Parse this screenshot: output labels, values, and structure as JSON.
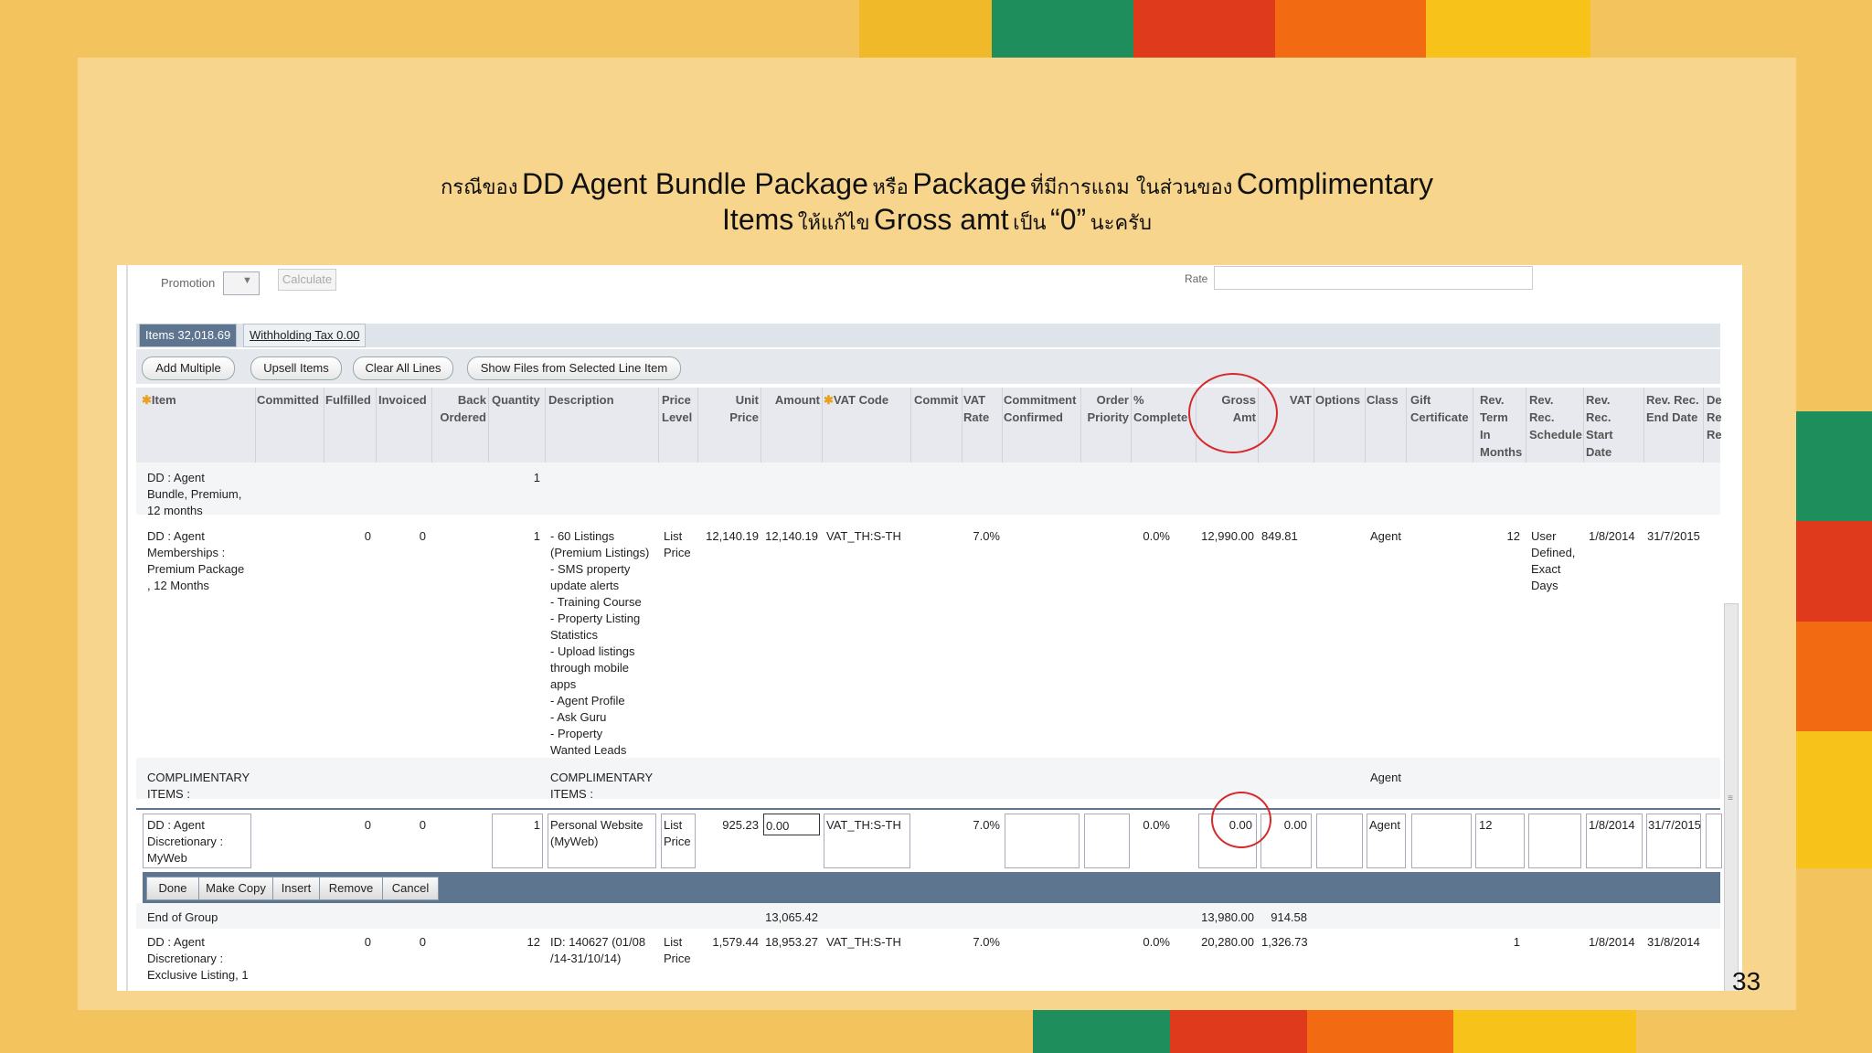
{
  "caption": {
    "line1_th1": "กรณีของ",
    "line1_en1": "DD Agent Bundle Package",
    "line1_th2": "หรือ",
    "line1_en2": "Package",
    "line1_th3": "ที่มีการแถม ในส่วนของ",
    "line1_en3": "Complimentary",
    "line2_en1": "Items",
    "line2_th1": "ให้แก้ไข",
    "line2_en2": "Gross amt",
    "line2_th2": "เป็น",
    "line2_en3": "“0”",
    "line2_th3": "นะครับ"
  },
  "page_number": "33",
  "form": {
    "promotion_label": "Promotion",
    "calculate_label": "Calculate",
    "rate_label": "Rate"
  },
  "tabs": {
    "items": "Items 32,018.69",
    "withholding": "Withholding Tax 0.00"
  },
  "toolbar": {
    "add_multiple": "Add Multiple",
    "upsell": "Upsell Items",
    "clear_all": "Clear All Lines",
    "show_files": "Show Files from Selected Line Item"
  },
  "headers": {
    "item": "Item",
    "committed": "Committed",
    "fulfilled": "Fulfilled",
    "invoiced": "Invoiced",
    "back_ordered_1": "Back",
    "back_ordered_2": "Ordered",
    "quantity": "Quantity",
    "description": "Description",
    "price_level_1": "Price",
    "price_level_2": "Level",
    "unit_price_1": "Unit",
    "unit_price_2": "Price",
    "amount": "Amount",
    "vat_code": "VAT Code",
    "commit": "Commit",
    "vat_rate_1": "VAT",
    "vat_rate_2": "Rate",
    "commitment_1": "Commitment",
    "commitment_2": "Confirmed",
    "order_priority_1": "Order",
    "order_priority_2": "Priority",
    "pct_complete_1": "%",
    "pct_complete_2": "Complete",
    "gross_amt_1": "Gross",
    "gross_amt_2": "Amt",
    "vat": "VAT",
    "options": "Options",
    "class": "Class",
    "gift_1": "Gift",
    "gift_2": "Certificate",
    "rev_term_1": "Rev.",
    "rev_term_2": "Term",
    "rev_term_3": "In",
    "rev_term_4": "Months",
    "rev_sched_1": "Rev.",
    "rev_sched_2": "Rec.",
    "rev_sched_3": "Schedule",
    "rev_start_1": "Rev.",
    "rev_start_2": "Rec.",
    "rev_start_3": "Start",
    "rev_start_4": "Date",
    "rev_end_1": "Rev. Rec.",
    "rev_end_2": "End Date",
    "de_1": "De",
    "de_2": "Re",
    "de_3": "Re"
  },
  "rows": {
    "bundle": {
      "item_1": "DD : Agent",
      "item_2": "Bundle, Premium,",
      "item_3": "12 months",
      "quantity": "1"
    },
    "membership": {
      "item_1": "DD : Agent",
      "item_2": "Memberships :",
      "item_3": "Premium Package",
      "item_4": ", 12 Months",
      "fulfilled": "0",
      "invoiced": "0",
      "quantity": "1",
      "desc": [
        "- 60 Listings",
        "(Premium Listings)",
        "- SMS property",
        "update alerts",
        "- Training Course",
        "- Property Listing",
        "Statistics",
        "- Upload listings",
        "through mobile",
        "apps",
        "- Agent Profile",
        "- Ask Guru",
        "- Property",
        "Wanted Leads"
      ],
      "price_level_1": "List",
      "price_level_2": "Price",
      "unit_price": "12,140.19",
      "amount": "12,140.19",
      "vat_code": "VAT_TH:S-TH",
      "vat_rate": "7.0%",
      "pct_complete": "0.0%",
      "gross_amt": "12,990.00",
      "vat": "849.81",
      "class": "Agent",
      "rev_term": "12",
      "rev_sched_1": "User",
      "rev_sched_2": "Defined,",
      "rev_sched_3": "Exact",
      "rev_sched_4": "Days",
      "rev_start": "1/8/2014",
      "rev_end": "31/7/2015"
    },
    "complimentary": {
      "item_1": "COMPLIMENTARY",
      "item_2": "ITEMS :",
      "desc_1": "COMPLIMENTARY",
      "desc_2": "ITEMS :",
      "class": "Agent"
    },
    "editing": {
      "item_1": "DD : Agent",
      "item_2": "Discretionary :",
      "item_3": "MyWeb",
      "fulfilled": "0",
      "invoiced": "0",
      "quantity": "1",
      "desc_1": "Personal Website",
      "desc_2": "(MyWeb)",
      "price_level_1": "List",
      "price_level_2": "Price",
      "unit_price": "925.23",
      "amount": "0.00",
      "vat_code": "VAT_TH:S-TH",
      "vat_rate": "7.0%",
      "pct_complete": "0.0%",
      "gross_amt": "0.00",
      "vat": "0.00",
      "class": "Agent",
      "rev_term": "12",
      "rev_start": "1/8/2014",
      "rev_end": "31/7/2015"
    },
    "actions": {
      "done": "Done",
      "make_copy": "Make Copy",
      "insert": "Insert",
      "remove": "Remove",
      "cancel": "Cancel"
    },
    "end_group": {
      "label": "End of Group",
      "amount": "13,065.42",
      "gross_amt": "13,980.00",
      "vat": "914.58"
    },
    "exclusive": {
      "item_1": "DD : Agent",
      "item_2": "Discretionary :",
      "item_3": "Exclusive Listing, 1",
      "fulfilled": "0",
      "invoiced": "0",
      "quantity": "12",
      "desc_1": "ID: 140627 (01/08",
      "desc_2": "/14-31/10/14)",
      "price_level_1": "List",
      "price_level_2": "Price",
      "unit_price": "1,579.44",
      "amount": "18,953.27",
      "vat_code": "VAT_TH:S-TH",
      "vat_rate": "7.0%",
      "pct_complete": "0.0%",
      "gross_amt": "20,280.00",
      "vat": "1,326.73",
      "rev_term": "1",
      "rev_start": "1/8/2014",
      "rev_end": "31/8/2014"
    }
  },
  "colors": {
    "background": "#f3c45e",
    "slide": "#f7d58c",
    "highlight_circle": "#d62a2a",
    "action_bar": "#5e7590"
  }
}
